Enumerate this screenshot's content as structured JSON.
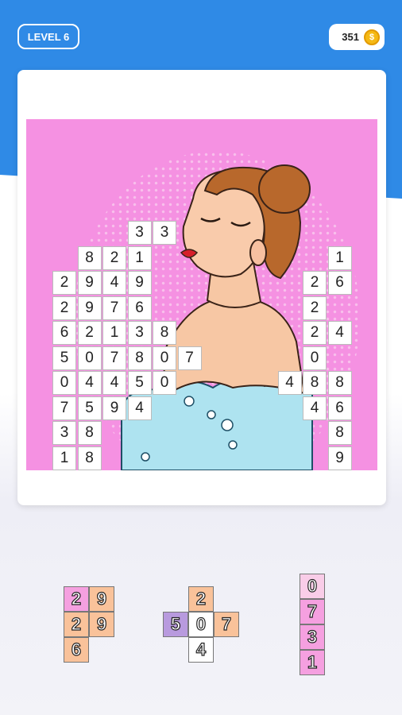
{
  "header": {
    "level_label": "LEVEL 6",
    "coins": "351",
    "coin_icon": "coin-icon"
  },
  "colors": {
    "header_blue": "#2f8ae6",
    "picture_bg": "#f591e2",
    "orange": "#f9c29a",
    "pink": "#f5a0e0",
    "light_pink": "#f9cde8",
    "purple": "#b89ade"
  },
  "board_rows": [
    [
      "",
      "",
      "",
      "3",
      "3",
      "",
      "",
      "",
      "",
      "",
      "",
      "",
      ""
    ],
    [
      "",
      "8",
      "2",
      "1",
      "",
      "",
      "",
      "",
      "",
      "",
      "",
      "1",
      ""
    ],
    [
      "2",
      "9",
      "4",
      "9",
      "",
      "",
      "",
      "",
      "",
      "",
      "2",
      "6",
      ""
    ],
    [
      "2",
      "9",
      "7",
      "6",
      "",
      "",
      "",
      "",
      "",
      "",
      "2",
      "",
      ""
    ],
    [
      "6",
      "2",
      "1",
      "3",
      "8",
      "",
      "",
      "",
      "",
      "",
      "2",
      "4",
      ""
    ],
    [
      "5",
      "0",
      "7",
      "8",
      "0",
      "7",
      "",
      "",
      "",
      "",
      "0",
      "",
      ""
    ],
    [
      "0",
      "4",
      "4",
      "5",
      "0",
      "",
      "",
      "",
      "",
      "4",
      "8",
      "8",
      ""
    ],
    [
      "7",
      "5",
      "9",
      "4",
      "",
      "",
      "",
      "",
      "",
      "",
      "4",
      "6",
      ""
    ],
    [
      "3",
      "8",
      "",
      "",
      "",
      "",
      "",
      "",
      "",
      "",
      "",
      "8",
      ""
    ],
    [
      "1",
      "8",
      "",
      "",
      "",
      "",
      "",
      "",
      "",
      "",
      "",
      "9",
      ""
    ]
  ],
  "pieces": [
    {
      "name": "piece-a",
      "cells": [
        {
          "v": "2",
          "color": "pink"
        },
        {
          "v": "9",
          "color": "orange"
        },
        {
          "v": "2",
          "color": "orange"
        },
        {
          "v": "9",
          "color": "orange"
        },
        {
          "v": "6",
          "color": "orange"
        }
      ]
    },
    {
      "name": "piece-b",
      "cells": [
        {
          "v": "2",
          "color": "orange"
        },
        {
          "v": "5",
          "color": "purple"
        },
        {
          "v": "0",
          "color": "white"
        },
        {
          "v": "7",
          "color": "orange"
        },
        {
          "v": "4",
          "color": "white"
        }
      ]
    },
    {
      "name": "piece-c",
      "cells": [
        {
          "v": "0",
          "color": "light_pink"
        },
        {
          "v": "7",
          "color": "pink"
        },
        {
          "v": "3",
          "color": "pink"
        },
        {
          "v": "1",
          "color": "pink"
        }
      ]
    }
  ]
}
